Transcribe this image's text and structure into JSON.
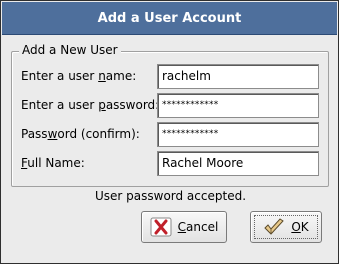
{
  "window": {
    "title": "Add a User Account"
  },
  "group": {
    "label": "Add a New User"
  },
  "fields": [
    {
      "label_pre": "Enter a user ",
      "label_key": "n",
      "label_post": "ame:",
      "value": "rachelm"
    },
    {
      "label_pre": "Enter a user ",
      "label_key": "p",
      "label_post": "assword:",
      "value": "************"
    },
    {
      "label_pre": "Pass",
      "label_key": "w",
      "label_post": "ord (confirm):",
      "value": "************"
    },
    {
      "label_pre": "",
      "label_key": "F",
      "label_post": "ull Name:",
      "value": "Rachel Moore"
    }
  ],
  "status": {
    "text": "User password accepted."
  },
  "buttons": {
    "cancel_key": "C",
    "cancel_rest": "ancel",
    "ok_key": "O",
    "ok_rest": "K",
    "cancel_icon": "x-cancel-icon",
    "ok_icon": "check-hand-icon"
  },
  "colors": {
    "titlebar": "#4e6f9c",
    "background": "#ebebeb",
    "cancel_icon_red": "#c0202a"
  }
}
